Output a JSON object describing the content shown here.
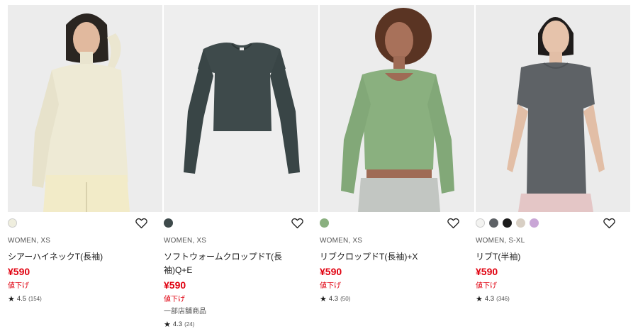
{
  "products": [
    {
      "segment": "WOMEN, XS",
      "name": "シアーハイネックT(長袖)",
      "price": "¥590",
      "sale": "値下げ",
      "store": "",
      "rating": "4.5",
      "reviews": "(154)",
      "colors": [
        "#efeede"
      ]
    },
    {
      "segment": "WOMEN, XS",
      "name": "ソフトウォームクロップドT(長袖)Q+E",
      "price": "¥590",
      "sale": "値下げ",
      "store": "一部店舗商品",
      "rating": "4.3",
      "reviews": "(24)",
      "colors": [
        "#3e4a4b"
      ]
    },
    {
      "segment": "WOMEN, XS",
      "name": "リブクロップドT(長袖)+X",
      "price": "¥590",
      "sale": "値下げ",
      "store": "",
      "rating": "4.3",
      "reviews": "(50)",
      "colors": [
        "#8ab07f"
      ]
    },
    {
      "segment": "WOMEN, S-XL",
      "name": "リブT(半袖)",
      "price": "¥590",
      "sale": "値下げ",
      "store": "",
      "rating": "4.3",
      "reviews": "(346)",
      "colors": [
        "#f3f3f1",
        "#5e6266",
        "#1b1b1b",
        "#d8cfc4",
        "#c9a6d6"
      ]
    }
  ],
  "icons": {
    "favorite": "heart-outline-icon",
    "rating": "star-icon"
  }
}
